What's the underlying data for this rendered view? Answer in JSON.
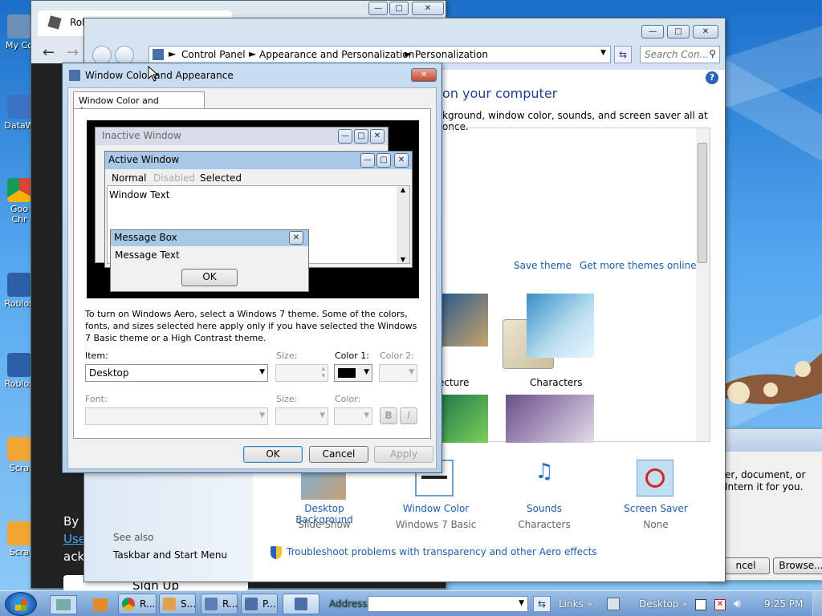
{
  "desktop": {
    "icons": [
      {
        "label": "My Co"
      },
      {
        "label": "DataW"
      },
      {
        "label": "Goo Chr"
      },
      {
        "label": "Roblox"
      },
      {
        "label": "Roblox"
      },
      {
        "label": "Scra"
      },
      {
        "label": "Scra"
      }
    ]
  },
  "browser_bg": {
    "tab_title": "Rob",
    "text_by": "By",
    "text_use": "Use",
    "text_ack": "ack",
    "text_signup": "Sign Up"
  },
  "control_panel": {
    "breadcrumb": [
      "Control Panel",
      "Appearance and Personalization",
      "Personalization"
    ],
    "search_placeholder": "Search Con...",
    "heading_fragment": "on your computer",
    "subtext_fragment": "kground, window color, sounds, and screen saver all at once.",
    "save_theme": "Save theme",
    "more_themes": "Get more themes online",
    "theme_labels": [
      "ecture",
      "Characters"
    ],
    "bottom_items": [
      {
        "title": "Desktop Background",
        "sub": "Slide Show"
      },
      {
        "title": "Window Color",
        "sub": "Windows 7 Basic"
      },
      {
        "title": "Sounds",
        "sub": "Characters"
      },
      {
        "title": "Screen Saver",
        "sub": "None"
      }
    ],
    "see_also": "See also",
    "taskbar_link": "Taskbar and Start Menu",
    "troubleshoot": "Troubleshoot problems with transparency and other Aero effects"
  },
  "right_dialog": {
    "text": "er, document, or Intern it for you.",
    "cancel": "ncel",
    "browse": "Browse..."
  },
  "dialog": {
    "title": "Window Color and Appearance",
    "tab": "Window Color and Appearance",
    "preview": {
      "inactive": "Inactive Window",
      "active": "Active Window",
      "menu": [
        "Normal",
        "Disabled",
        "Selected"
      ],
      "window_text": "Window Text",
      "message_box": "Message Box",
      "message_text": "Message Text",
      "ok": "OK"
    },
    "info": "To turn on Windows Aero, select a Windows 7 theme.  Some of the colors, fonts, and sizes selected here apply only if you have selected the Windows 7 Basic theme or a High Contrast theme.",
    "item_label": "Item:",
    "item_value": "Desktop",
    "size_label": "Size:",
    "color1_label": "Color 1:",
    "color2_label": "Color 2:",
    "font_label": "Font:",
    "size2_label": "Size:",
    "color_label": "Color:",
    "bold": "B",
    "italic": "I",
    "ok": "OK",
    "cancel": "Cancel",
    "apply": "Apply"
  },
  "taskbar": {
    "buttons": [
      "R...",
      "S...",
      "R...",
      "P..."
    ],
    "address_label": "Address",
    "links": "Links",
    "desktop": "Desktop",
    "time": "9:25 PM"
  },
  "colors": {
    "accent": "#1e5cad",
    "title_active": "#a9c7e6",
    "title_inactive": "#d6dde8"
  }
}
